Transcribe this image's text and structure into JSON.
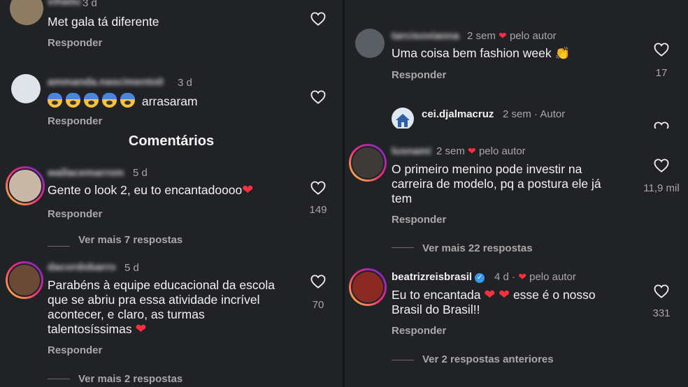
{
  "left": {
    "panel1": {
      "c1": {
        "username": "vihailu",
        "time": "3 d",
        "text": "Met gala tá diferente",
        "reply": "Responder"
      },
      "c2": {
        "username": "ammanda.nascimento0",
        "time": "3 d",
        "emoji_count": 5,
        "emoji_icon": "fearful-face-emoji",
        "text": "arrasaram",
        "reply": "Responder"
      }
    },
    "panel2": {
      "title": "Comentários",
      "c1": {
        "username": "wallacemarrom",
        "time": "5 d",
        "text": "Gente o look 2, eu to encantadoooo",
        "likes": "149",
        "reply": "Responder",
        "more": "Ver mais 7 respostas"
      }
    },
    "panel3": {
      "c1": {
        "username": "dacordobarro",
        "time": "5 d",
        "text_lines": [
          "Parabéns à equipe educacional da escola",
          "que se abriu pra essa atividade incrível",
          "acontecer, e claro, as turmas",
          "talentosíssimas"
        ],
        "likes": "70",
        "reply": "Responder",
        "more": "Ver mais 2 respostas"
      }
    }
  },
  "right": {
    "panel4": {
      "c1": {
        "username": "tarcisovianna",
        "time": "2 sem",
        "author_tag": "pelo autor",
        "text": "Uma coisa bem fashion week",
        "likes": "17",
        "reply": "Responder"
      },
      "c2": {
        "username": "cei.djalmacruz",
        "time": "2 sem",
        "author_tag": "Autor"
      }
    },
    "panel5": {
      "c1": {
        "username": "lusnami",
        "time": "2 sem",
        "author_tag": "pelo autor",
        "text_lines": [
          "O primeiro menino pode investir na",
          "carreira de modelo, pq a postura ele já",
          "tem"
        ],
        "likes": "11,9 mil",
        "reply": "Responder",
        "more": "Ver mais 22 respostas"
      }
    },
    "panel6": {
      "c1": {
        "username": "beatrizreisbrasil",
        "time": "4 d",
        "author_tag": "pelo autor",
        "text_a": "Eu to encantada",
        "text_b": "esse é o nosso",
        "text_line2": "Brasil do Brasil!!",
        "likes": "331",
        "reply": "Responder",
        "more": "Ver 2 respostas anteriores"
      }
    }
  },
  "colors": {
    "background": "#202225",
    "text": "#f2f2f2",
    "muted": "#a8a8a8",
    "heart_red": "#ff2f40",
    "verified": "#3897f0"
  }
}
